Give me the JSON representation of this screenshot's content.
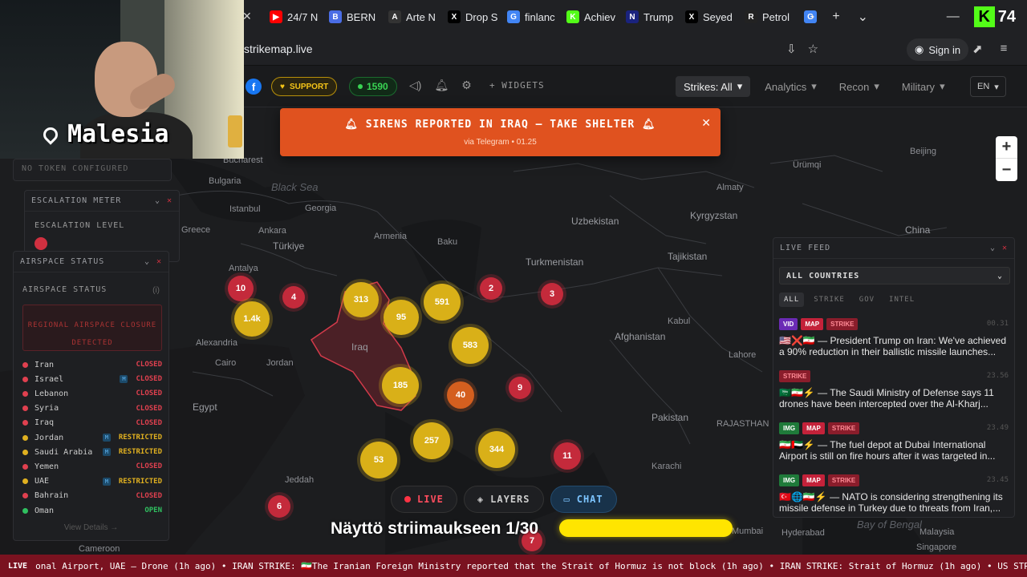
{
  "browser": {
    "tabs": [
      {
        "label": "24/7 N",
        "icon": "youtube-icon",
        "color": "#ff0000",
        "glyph": "▶"
      },
      {
        "label": "BERN",
        "icon": "b-app-icon",
        "color": "#4a6de5",
        "glyph": "B"
      },
      {
        "label": "Arte N",
        "icon": "arte-icon",
        "color": "#333333",
        "glyph": "A"
      },
      {
        "label": "Drop S",
        "icon": "x-icon",
        "color": "#000000",
        "glyph": "X"
      },
      {
        "label": "finlanc",
        "icon": "google-icon",
        "color": "#4285f4",
        "glyph": "G"
      },
      {
        "label": "Achiev",
        "icon": "kick-icon",
        "color": "#53fc18",
        "glyph": "K"
      },
      {
        "label": "Trump",
        "icon": "news-icon",
        "color": "#1a237e",
        "glyph": "N"
      },
      {
        "label": "Seyed",
        "icon": "x-icon",
        "color": "#000000",
        "glyph": "X"
      },
      {
        "label": "Petrol",
        "icon": "r-icon",
        "color": "#222222",
        "glyph": "R"
      },
      {
        "label": "",
        "icon": "google-icon",
        "color": "#4285f4",
        "glyph": "G"
      }
    ],
    "url": "strikemap.live",
    "sign_in": "Sign in",
    "kick_viewers": "74"
  },
  "header": {
    "support": "SUPPORT",
    "viewers": "1590",
    "widgets": "+ WIDGETS",
    "nav": [
      {
        "label": "Strikes: All",
        "active": true
      },
      {
        "label": "Analytics",
        "active": false
      },
      {
        "label": "Recon",
        "active": false
      },
      {
        "label": "Military",
        "active": false
      }
    ],
    "lang": "EN"
  },
  "siren": {
    "text": "SIRENS REPORTED IN IRAQ — TAKE SHELTER",
    "sub": "via Telegram • 01.25"
  },
  "webcam": {
    "location": "Malesia"
  },
  "token_panel": "NO TOKEN CONFIGURED",
  "escalation": {
    "title": "ESCALATION METER",
    "level_label": "ESCALATION LEVEL"
  },
  "airspace": {
    "panel_title": "AIRSPACE STATUS",
    "title": "AIRSPACE STATUS",
    "info": "(i)",
    "closure_line1": "REGIONAL AIRSPACE CLOSURE",
    "closure_line2": "DETECTED",
    "rows": [
      {
        "name": "Iran",
        "status": "CLOSED",
        "dot": "#e0404f",
        "m": false
      },
      {
        "name": "Israel",
        "status": "CLOSED",
        "dot": "#e0404f",
        "m": true
      },
      {
        "name": "Lebanon",
        "status": "CLOSED",
        "dot": "#e0404f",
        "m": false
      },
      {
        "name": "Syria",
        "status": "CLOSED",
        "dot": "#e0404f",
        "m": false
      },
      {
        "name": "Iraq",
        "status": "CLOSED",
        "dot": "#e0404f",
        "m": false
      },
      {
        "name": "Jordan",
        "status": "RESTRICTED",
        "dot": "#e0b020",
        "m": true
      },
      {
        "name": "Saudi Arabia",
        "status": "RESTRICTED",
        "dot": "#e0b020",
        "m": true
      },
      {
        "name": "Yemen",
        "status": "CLOSED",
        "dot": "#e0404f",
        "m": false
      },
      {
        "name": "UAE",
        "status": "RESTRICTED",
        "dot": "#e0b020",
        "m": true
      },
      {
        "name": "Bahrain",
        "status": "CLOSED",
        "dot": "#e0404f",
        "m": false
      },
      {
        "name": "Oman",
        "status": "OPEN",
        "dot": "#30c060",
        "m": false
      }
    ],
    "m_label": "M",
    "view_details": "View Details →"
  },
  "feed": {
    "title": "LIVE FEED",
    "country": "ALL COUNTRIES",
    "tabs": [
      "ALL",
      "STRIKE",
      "GOV",
      "INTEL"
    ],
    "items": [
      {
        "tags": [
          "VID",
          "MAP",
          "STRIKE"
        ],
        "time": "00.31",
        "text": "🇺🇸❌🇮🇷 — President Trump on Iran: We've achieved a 90% reduction in their ballistic missile launches..."
      },
      {
        "tags": [
          "STRIKE"
        ],
        "time": "23.56",
        "text": "🇸🇦🇮🇷⚡ — The Saudi Ministry of Defense says 11 drones have been intercepted over the Al-Kharj..."
      },
      {
        "tags": [
          "IMG",
          "MAP",
          "STRIKE"
        ],
        "time": "23.49",
        "text": "🇮🇷🇦🇪⚡ — The fuel depot at Dubai International Airport is still on fire hours after it was targeted in..."
      },
      {
        "tags": [
          "IMG",
          "MAP",
          "STRIKE"
        ],
        "time": "23.45",
        "text": "🇹🇷🌐🇮🇷⚡ — NATO is considering strengthening its missile defense in Turkey due to threats from Iran,..."
      }
    ]
  },
  "map": {
    "labels": [
      {
        "t": "Black Sea",
        "cls": "sea"
      },
      {
        "t": "Bucharest"
      },
      {
        "t": "Bulgaria"
      },
      {
        "t": "Istanbul"
      },
      {
        "t": "Ankara"
      },
      {
        "t": "Türkiye",
        "cls": "big"
      },
      {
        "t": "Greece"
      },
      {
        "t": "Antalya"
      },
      {
        "t": "Georgia"
      },
      {
        "t": "Armenia"
      },
      {
        "t": "Baku"
      },
      {
        "t": "Alexandria"
      },
      {
        "t": "Cairo"
      },
      {
        "t": "Jordan"
      },
      {
        "t": "Egypt",
        "cls": "big"
      },
      {
        "t": "Iraq",
        "cls": "big"
      },
      {
        "t": "Turkmenistan",
        "cls": "big"
      },
      {
        "t": "Uzbekistan",
        "cls": "big"
      },
      {
        "t": "Kyrgyzstan",
        "cls": "big"
      },
      {
        "t": "Tajikistan",
        "cls": "big"
      },
      {
        "t": "Afghanistan",
        "cls": "big"
      },
      {
        "t": "Kabul"
      },
      {
        "t": "Lahore"
      },
      {
        "t": "Pakistan",
        "cls": "big"
      },
      {
        "t": "Karachi"
      },
      {
        "t": "Almaty"
      },
      {
        "t": "Ürümqi"
      },
      {
        "t": "China",
        "cls": "big"
      },
      {
        "t": "Beijing"
      },
      {
        "t": "Jeddah"
      },
      {
        "t": "Hyderabad"
      },
      {
        "t": "Bay of Bengal",
        "cls": "sea"
      },
      {
        "t": "Malaysia"
      },
      {
        "t": "Singapore"
      },
      {
        "t": "Cameroon"
      },
      {
        "t": "Mumbai"
      },
      {
        "t": "RAJASTHAN"
      }
    ],
    "clusters": [
      {
        "n": "10",
        "c": "r"
      },
      {
        "n": "4",
        "c": "r"
      },
      {
        "n": "1.4k",
        "c": "y"
      },
      {
        "n": "313",
        "c": "y"
      },
      {
        "n": "95",
        "c": "y"
      },
      {
        "n": "591",
        "c": "y"
      },
      {
        "n": "2",
        "c": "r"
      },
      {
        "n": "3",
        "c": "r"
      },
      {
        "n": "583",
        "c": "y"
      },
      {
        "n": "9",
        "c": "r"
      },
      {
        "n": "185",
        "c": "y"
      },
      {
        "n": "40",
        "c": "o"
      },
      {
        "n": "257",
        "c": "y"
      },
      {
        "n": "344",
        "c": "y"
      },
      {
        "n": "11",
        "c": "r"
      },
      {
        "n": "53",
        "c": "y"
      },
      {
        "n": "6",
        "c": "r"
      },
      {
        "n": "7",
        "c": "r"
      }
    ]
  },
  "bottom": {
    "live": "LIVE",
    "layers": "LAYERS",
    "chat": "CHAT"
  },
  "overlay": {
    "share": "Näyttö striimaukseen 1/30"
  },
  "ticker": {
    "live": "LIVE",
    "text": "onal Airport, UAE — Drone (1h ago) • IRAN STRIKE: 🇮🇷The Iranian Foreign Ministry reported that the Strait of Hormuz is not block (1h ago) • IRAN STRIKE: Strait of Hormuz (1h ago) • US STRIKE: Iran"
  }
}
